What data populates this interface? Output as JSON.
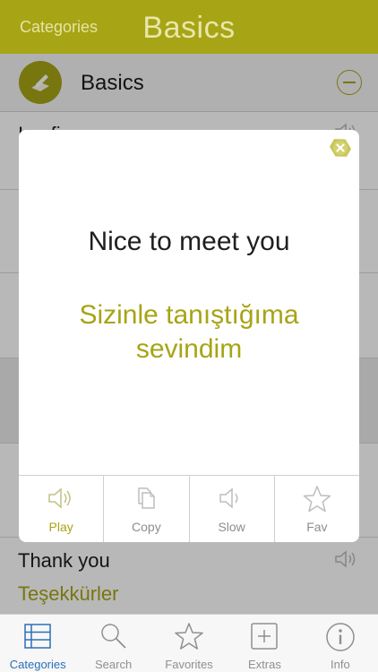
{
  "header": {
    "back_label": "Categories",
    "title": "Basics"
  },
  "section": {
    "label": "Basics",
    "icon": "pencil-paper-icon"
  },
  "list": {
    "rows": [
      {
        "en": "I ... fi ...",
        "tr": ""
      },
      {
        "en": "",
        "tr": ""
      },
      {
        "en": "",
        "tr": ""
      },
      {
        "en": "",
        "tr": ""
      },
      {
        "en": "",
        "tr": ""
      },
      {
        "en": "Thank you",
        "tr": "Teşekkürler"
      }
    ]
  },
  "modal": {
    "phrase": "Nice to meet you",
    "translation": "Sizinle tanıştığıma sevindim",
    "actions": [
      {
        "label": "Play",
        "icon": "speaker-icon",
        "active": true
      },
      {
        "label": "Copy",
        "icon": "copy-icon",
        "active": false
      },
      {
        "label": "Slow",
        "icon": "speaker-slow-icon",
        "active": false
      },
      {
        "label": "Fav",
        "icon": "star-icon",
        "active": false
      }
    ]
  },
  "tabs": [
    {
      "label": "Categories",
      "icon": "list-icon",
      "active": true
    },
    {
      "label": "Search",
      "icon": "search-icon",
      "active": false
    },
    {
      "label": "Favorites",
      "icon": "star-icon",
      "active": false
    },
    {
      "label": "Extras",
      "icon": "plus-icon",
      "active": false
    },
    {
      "label": "Info",
      "icon": "info-icon",
      "active": false
    }
  ],
  "colors": {
    "accent": "#a7a416",
    "tab_active": "#2b6fb8"
  }
}
